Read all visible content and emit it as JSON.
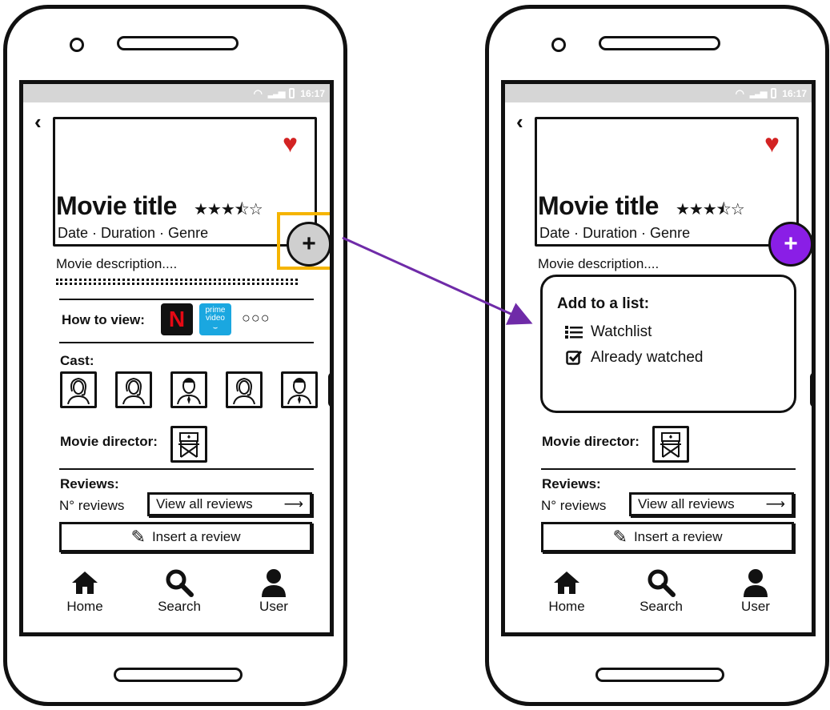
{
  "status_bar": {
    "time": "16:17"
  },
  "movie": {
    "title": "Movie title",
    "stars": "★★★⯪☆",
    "meta": "Date · Duration · Genre",
    "description": "Movie description...."
  },
  "how_to_view": {
    "label": "How to view:",
    "netflix_letter": "N",
    "prime_line1": "prime",
    "prime_line2": "video",
    "more": "○○○"
  },
  "cast": {
    "label": "Cast:"
  },
  "director": {
    "label": "Movie director:"
  },
  "reviews": {
    "label": "Reviews:",
    "count": "N° reviews",
    "view_all": "View all reviews",
    "insert": "Insert a review"
  },
  "nav": {
    "home": "Home",
    "search": "Search",
    "user": "User"
  },
  "add_popup": {
    "title": "Add to a list:",
    "items": [
      "Watchlist",
      "Already watched"
    ]
  },
  "colors": {
    "heart": "#d32323",
    "highlight": "#f5b400",
    "accent_purple": "#8a1ee6",
    "status_bar": "#d6d6d6"
  },
  "icons": [
    "back-chevron-icon",
    "heart-icon",
    "plus-icon",
    "wifi-icon",
    "signal-icon",
    "battery-icon",
    "netflix-logo",
    "prime-video-logo",
    "pencil-icon",
    "home-icon",
    "search-icon",
    "user-icon",
    "list-icon",
    "checkbox-icon",
    "arrow-right-icon"
  ]
}
